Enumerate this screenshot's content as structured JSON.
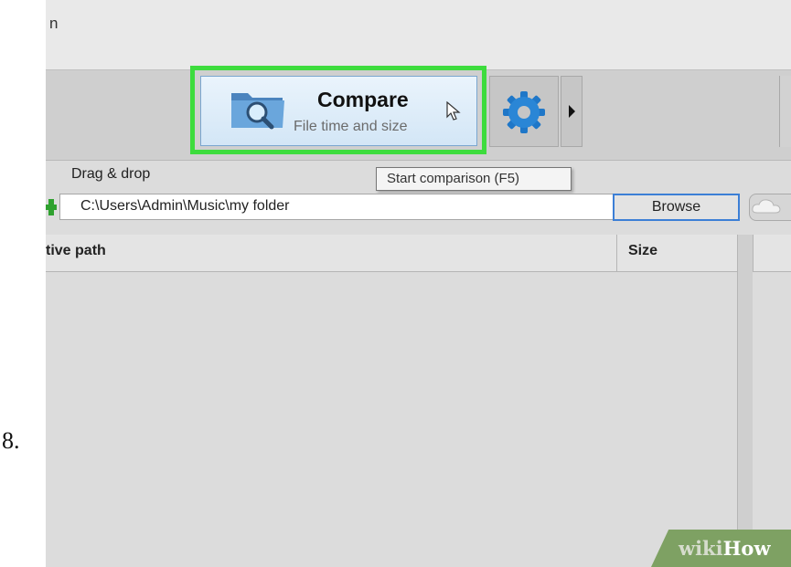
{
  "step": {
    "number": "8."
  },
  "window": {
    "title_fragment": "n"
  },
  "toolbar": {
    "compare_label": "Compare",
    "compare_sublabel": "File time and size",
    "icons": [
      "folder-search-icon",
      "gear-icon",
      "chevron-right-icon",
      "mouse-cursor-icon"
    ]
  },
  "tooltip": {
    "text": "Start comparison (F5)"
  },
  "left_panel": {
    "drag_drop_label": "Drag & drop",
    "path_value": "C:\\Users\\Admin\\Music\\my folder",
    "browse_label": "Browse"
  },
  "table": {
    "columns": [
      "tive path",
      "Size"
    ]
  },
  "watermark": {
    "part1": "wiki",
    "part2": "How"
  },
  "colors": {
    "highlight": "#3ddc3d",
    "compare_button_bg": "#dcebf8",
    "browse_border": "#3c7fd6",
    "watermark_bg": "#7ea163"
  }
}
